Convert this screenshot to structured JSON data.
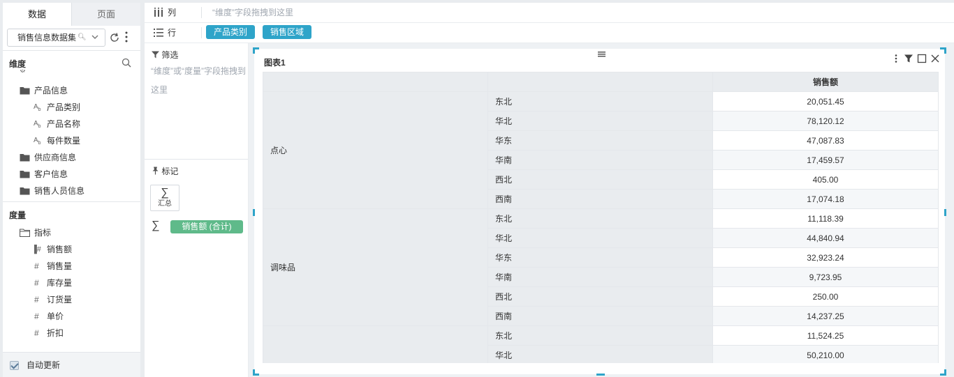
{
  "left": {
    "tabs": [
      {
        "label": "数据"
      },
      {
        "label": "页面"
      }
    ],
    "dataset": {
      "value": "销售信息数据集"
    },
    "dimensions": {
      "title": "维度",
      "items": [
        {
          "label": "产品信息",
          "type": "folder"
        },
        {
          "label": "产品类别",
          "type": "text"
        },
        {
          "label": "产品名称",
          "type": "text"
        },
        {
          "label": "每件数量",
          "type": "text"
        },
        {
          "label": "供应商信息",
          "type": "folder"
        },
        {
          "label": "客户信息",
          "type": "folder"
        },
        {
          "label": "销售人员信息",
          "type": "folder"
        }
      ]
    },
    "measures": {
      "title": "度量",
      "items": [
        {
          "label": "指标",
          "type": "folder"
        },
        {
          "label": "销售额",
          "type": "measure-used"
        },
        {
          "label": "销售量",
          "type": "number"
        },
        {
          "label": "库存量",
          "type": "number"
        },
        {
          "label": "订货量",
          "type": "number"
        },
        {
          "label": "单价",
          "type": "number"
        },
        {
          "label": "折扣",
          "type": "number"
        }
      ]
    },
    "auto_update": {
      "label": "自动更新",
      "checked": true
    }
  },
  "shelves": {
    "columns": {
      "label": "列",
      "hint": "“维度”字段拖拽到这里"
    },
    "rows": {
      "label": "行",
      "pills": [
        "产品类别",
        "销售区域"
      ]
    }
  },
  "filter": {
    "title": "筛选",
    "hint": "“维度”或“度量”字段拖拽到这里"
  },
  "marks": {
    "title": "标记",
    "summary_label": "汇总",
    "measure_pill": "销售额 (合计)"
  },
  "chart": {
    "title": "图表1",
    "header": {
      "col1": "",
      "col2": "",
      "col3": "销售额"
    },
    "groups": [
      {
        "category": "点心",
        "rows": [
          {
            "region": "东北",
            "value": "20,051.45"
          },
          {
            "region": "华北",
            "value": "78,120.12"
          },
          {
            "region": "华东",
            "value": "47,087.83"
          },
          {
            "region": "华南",
            "value": "17,459.57"
          },
          {
            "region": "西北",
            "value": "405.00"
          },
          {
            "region": "西南",
            "value": "17,074.18"
          }
        ]
      },
      {
        "category": "调味品",
        "rows": [
          {
            "region": "东北",
            "value": "11,118.39"
          },
          {
            "region": "华北",
            "value": "44,840.94"
          },
          {
            "region": "华东",
            "value": "32,923.24"
          },
          {
            "region": "华南",
            "value": "9,723.95"
          },
          {
            "region": "西北",
            "value": "250.00"
          },
          {
            "region": "西南",
            "value": "14,237.25"
          }
        ]
      },
      {
        "category": "",
        "rows": [
          {
            "region": "东北",
            "value": "11,524.25"
          },
          {
            "region": "华北",
            "value": "50,210.00"
          }
        ]
      }
    ]
  },
  "colors": {
    "accent": "#2ea4c9",
    "measure_green": "#5fba8a"
  }
}
